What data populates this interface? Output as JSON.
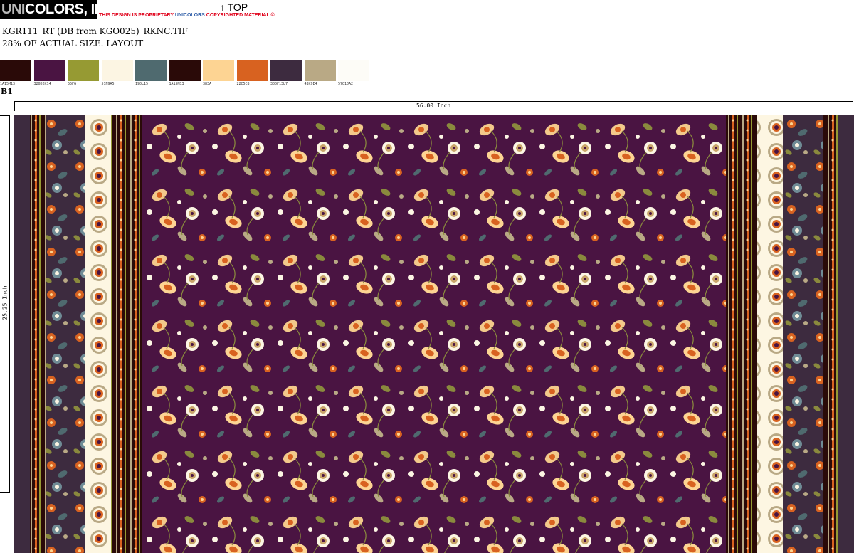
{
  "header": {
    "logo_prefix": "UNI",
    "logo_suffix": "COLORS, INC.",
    "notice_prefix": "THIS DESIGN IS PROPRIETARY ",
    "notice_brand": "UNICOLORS",
    "notice_suffix": " COPYRIGHTED MATERIAL ©",
    "top_label": "↑ TOP",
    "filename": "KGR111_RT (DB from KGO025)_RKNC.TIF",
    "scale": "28% OF ACTUAL SIZE. LAYOUT"
  },
  "palette": [
    {
      "code": "1A15M13",
      "color": "#2a0a08"
    },
    {
      "code": "320D2K14",
      "color": "#4a1442"
    },
    {
      "code": "55FG",
      "color": "#969a33"
    },
    {
      "code": "51N9A5",
      "color": "#fcf5e3"
    },
    {
      "code": "190L15",
      "color": "#4f6a6f"
    },
    {
      "code": "1A15M13",
      "color": "#2a0a08"
    },
    {
      "code": "383A",
      "color": "#fdd493"
    },
    {
      "code": "22C5C8",
      "color": "#d86220"
    },
    {
      "code": "300F13L7",
      "color": "#3d2b3f"
    },
    {
      "code": "43K9E4",
      "color": "#b9a985"
    },
    {
      "code": "57O10A2",
      "color": "#fdfcf7"
    }
  ],
  "colorway": "B1",
  "rulers": {
    "width_label": "56.00 Inch",
    "height_label": "25.25 Inch"
  }
}
